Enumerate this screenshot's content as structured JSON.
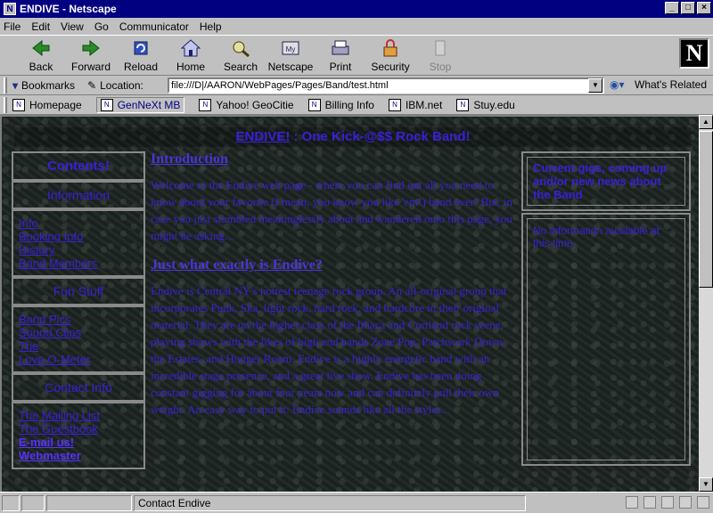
{
  "window": {
    "title": "ENDIVE - Netscape",
    "minimize": "_",
    "maximize": "□",
    "close": "×"
  },
  "menu": [
    "File",
    "Edit",
    "View",
    "Go",
    "Communicator",
    "Help"
  ],
  "toolbar": [
    {
      "label": "Back",
      "icon": "back-arrow-icon"
    },
    {
      "label": "Forward",
      "icon": "forward-arrow-icon"
    },
    {
      "label": "Reload",
      "icon": "reload-icon"
    },
    {
      "label": "Home",
      "icon": "home-icon"
    },
    {
      "label": "Search",
      "icon": "search-icon"
    },
    {
      "label": "Netscape",
      "icon": "netscape-icon"
    },
    {
      "label": "Print",
      "icon": "print-icon"
    },
    {
      "label": "Security",
      "icon": "lock-icon"
    },
    {
      "label": "Stop",
      "icon": "stop-icon",
      "disabled": true
    }
  ],
  "location": {
    "bookmarks_label": "Bookmarks",
    "location_label": "Location:",
    "url": "file:///D|/AARON/WebPages/Pages/Band/test.html",
    "whats_related": "What's Related"
  },
  "personal": [
    "Homepage",
    "GenNeXt MB",
    "Yahoo! GeoCitie",
    "Billing Info",
    "IBM.net",
    "Stuy.edu"
  ],
  "page": {
    "headline_link": "ENDIVE!",
    "headline_rest": " : One Kick-@$$ Rock Band!",
    "nav_title": "Contents!",
    "sections": [
      {
        "head": "Information",
        "links": [
          "Info",
          "Booking Info",
          "History",
          "Band Members"
        ]
      },
      {
        "head": "Fun Stuff",
        "links": [
          "Band Pics",
          "Sound Clips",
          "The",
          "Love-O-Meter"
        ]
      },
      {
        "head": "Contact Info",
        "links": [
          "The Mailing List",
          "The Guestbook",
          "E-mail us!",
          "Webmaster"
        ]
      }
    ],
    "intro_title": "Introduction",
    "intro_text": "Welcome to the Endive web page - where you can find out all you need to know about your favorite (I mean, you know you like 'em!) band ever! But, in case you just stumbled meaninglessly about and wandered onto this page, you might be asking...",
    "q_title": "Just what exactly is Endive?",
    "q_text": "Endive is Central NY's hottest teenage rock group. An all-original group that incorporates Punk, Ska, light rock, hard rock, and hardcore in their original material. They are on the higher class of the Ithaca and Cortland rock scene, playing shows with the likes of high end bands Zone Pop, Patchwork Down, the Estates, and Hunger Room. Endive is a highly energetic band with an incredible stage presence, and a great live show. Endive has been doing constant gigging for about four years now and can definitely pull their own weight. An easy way to put it: Endive sounds like all the styles...",
    "right_head": "Current gigs, coming up and/or new news about the Band",
    "right_body": "No information available at this time."
  },
  "status": {
    "text": "Contact Endive"
  }
}
